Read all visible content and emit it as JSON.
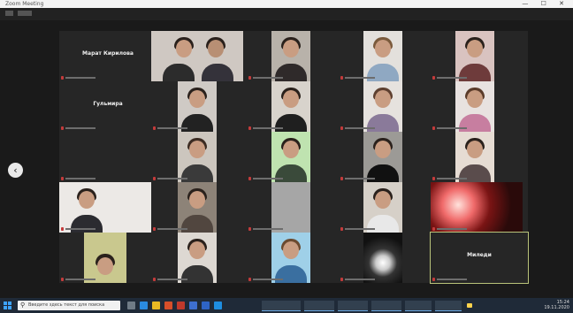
{
  "window": {
    "title": "Zoom Meeting",
    "controls": "— ☐ ✕"
  },
  "raise_hand_icon": "✋",
  "nav": {
    "prev_icon": "‹"
  },
  "named_tiles": {
    "r1c1": "Марат Кирилова",
    "r2c1": "Гульмира",
    "r5c6": "Миледи"
  },
  "taskbar": {
    "search_icon": "⚲",
    "search_placeholder": "Введите здесь текст для поиска",
    "time": "15:24",
    "date": "19.11.2020"
  },
  "colors": {
    "accent": "#b9c37a",
    "taskbar": "#1f2a38",
    "mic_muted": "#c43b3b"
  }
}
